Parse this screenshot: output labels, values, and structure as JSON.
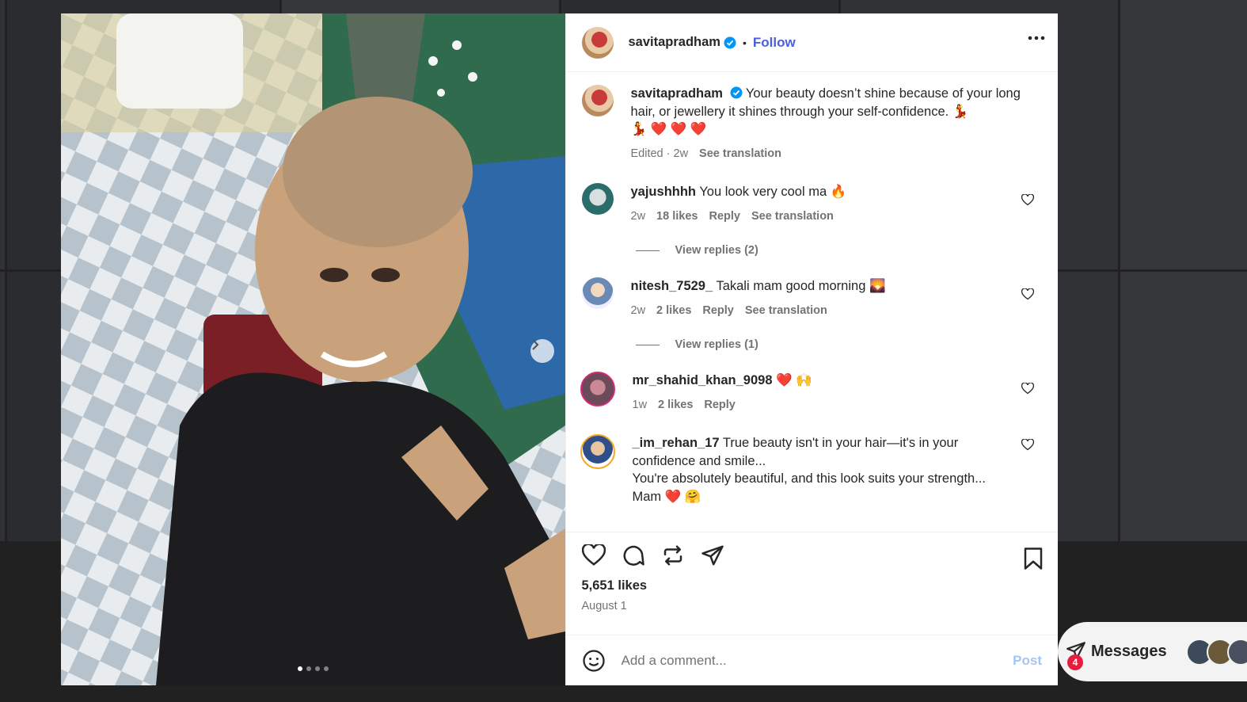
{
  "post": {
    "author": "savitapradham",
    "follow_label": "Follow",
    "separator": "•",
    "caption_text": "Your beauty doesn’t shine because of your long hair, or jewellery it shines through your self-confidence. 💃",
    "caption_emojis": "💃 ❤️ ❤️ ❤️",
    "caption_meta": "Edited · 2w",
    "see_translation": "See translation",
    "likes": "5,651 likes",
    "date": "August 1",
    "carousel_count": 4,
    "carousel_active": 1
  },
  "comments": [
    {
      "user": "yajushhhh",
      "text": "You look very cool ma 🔥",
      "age": "2w",
      "likes": "18 likes",
      "reply": "Reply",
      "translate": "See translation",
      "view_replies": "View replies (2)"
    },
    {
      "user": "nitesh_7529_",
      "text": "Takali mam good morning 🌄",
      "age": "2w",
      "likes": "2 likes",
      "reply": "Reply",
      "translate": "See translation",
      "view_replies": "View replies (1)"
    },
    {
      "user": "mr_shahid_khan_9098",
      "text": "❤️ 🙌",
      "age": "1w",
      "likes": "2 likes",
      "reply": "Reply"
    },
    {
      "user": "_im_rehan_17",
      "text": "True beauty isn't in your hair—it's in your confidence and smile...",
      "text2": "You're absolutely beautiful, and this look suits your strength...",
      "text3": "Mam ❤️ 🤗"
    }
  ],
  "composer": {
    "placeholder": "Add a comment...",
    "post_label": "Post"
  },
  "messages": {
    "label": "Messages",
    "badge": "4"
  },
  "colors": {
    "link_blue": "#4c5fd7",
    "verified_blue": "#0095f6",
    "heart_red": "#ed2e59",
    "post_disabled": "#a5c3f5"
  },
  "icons": [
    "verified-badge-icon",
    "more-options-icon",
    "carousel-next-icon",
    "heart-icon",
    "comment-icon",
    "repost-icon",
    "share-icon",
    "bookmark-icon",
    "emoji-icon",
    "messages-icon"
  ]
}
